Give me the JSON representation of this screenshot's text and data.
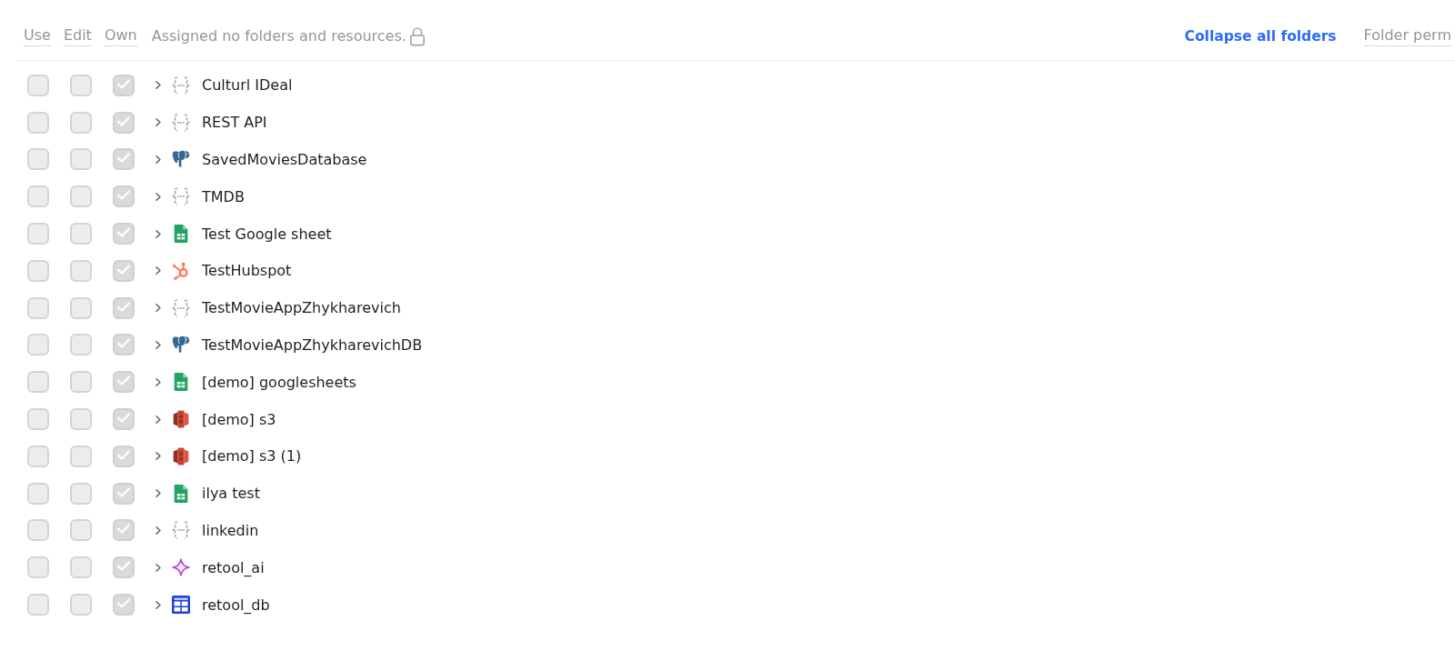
{
  "header": {
    "columns": [
      {
        "label": "Use"
      },
      {
        "label": "Edit"
      },
      {
        "label": "Own"
      }
    ],
    "notice": "Assigned no folders and resources.",
    "collapse_link": "Collapse all folders",
    "column_4": "Folder perm"
  },
  "rows": [
    {
      "name": "Culturl IDeal",
      "kind": "api",
      "expanded": false,
      "use": false,
      "edit": false,
      "own": true
    },
    {
      "name": "REST API",
      "kind": "api",
      "expanded": false,
      "use": false,
      "edit": false,
      "own": true
    },
    {
      "name": "SavedMoviesDatabase",
      "kind": "postgres",
      "expanded": false,
      "use": false,
      "edit": false,
      "own": true
    },
    {
      "name": "TMDB",
      "kind": "api",
      "expanded": false,
      "use": false,
      "edit": false,
      "own": true
    },
    {
      "name": "Test Google sheet",
      "kind": "sheets",
      "expanded": false,
      "use": false,
      "edit": false,
      "own": true
    },
    {
      "name": "TestHubspot",
      "kind": "hubspot",
      "expanded": false,
      "use": false,
      "edit": false,
      "own": true
    },
    {
      "name": "TestMovieAppZhykharevich",
      "kind": "api",
      "expanded": false,
      "use": false,
      "edit": false,
      "own": true
    },
    {
      "name": "TestMovieAppZhykharevichDB",
      "kind": "postgres",
      "expanded": false,
      "use": false,
      "edit": false,
      "own": true
    },
    {
      "name": "[demo] googlesheets",
      "kind": "sheets",
      "expanded": false,
      "use": false,
      "edit": false,
      "own": true
    },
    {
      "name": "[demo] s3",
      "kind": "s3",
      "expanded": false,
      "use": false,
      "edit": false,
      "own": true
    },
    {
      "name": "[demo] s3 (1)",
      "kind": "s3",
      "expanded": false,
      "use": false,
      "edit": false,
      "own": true
    },
    {
      "name": "ilya test",
      "kind": "sheets",
      "expanded": false,
      "use": false,
      "edit": false,
      "own": true
    },
    {
      "name": "linkedin",
      "kind": "api",
      "expanded": false,
      "use": false,
      "edit": false,
      "own": true
    },
    {
      "name": "retool_ai",
      "kind": "ai",
      "expanded": false,
      "use": false,
      "edit": false,
      "own": true
    },
    {
      "name": "retool_db",
      "kind": "db",
      "expanded": false,
      "use": false,
      "edit": false,
      "own": true
    }
  ]
}
